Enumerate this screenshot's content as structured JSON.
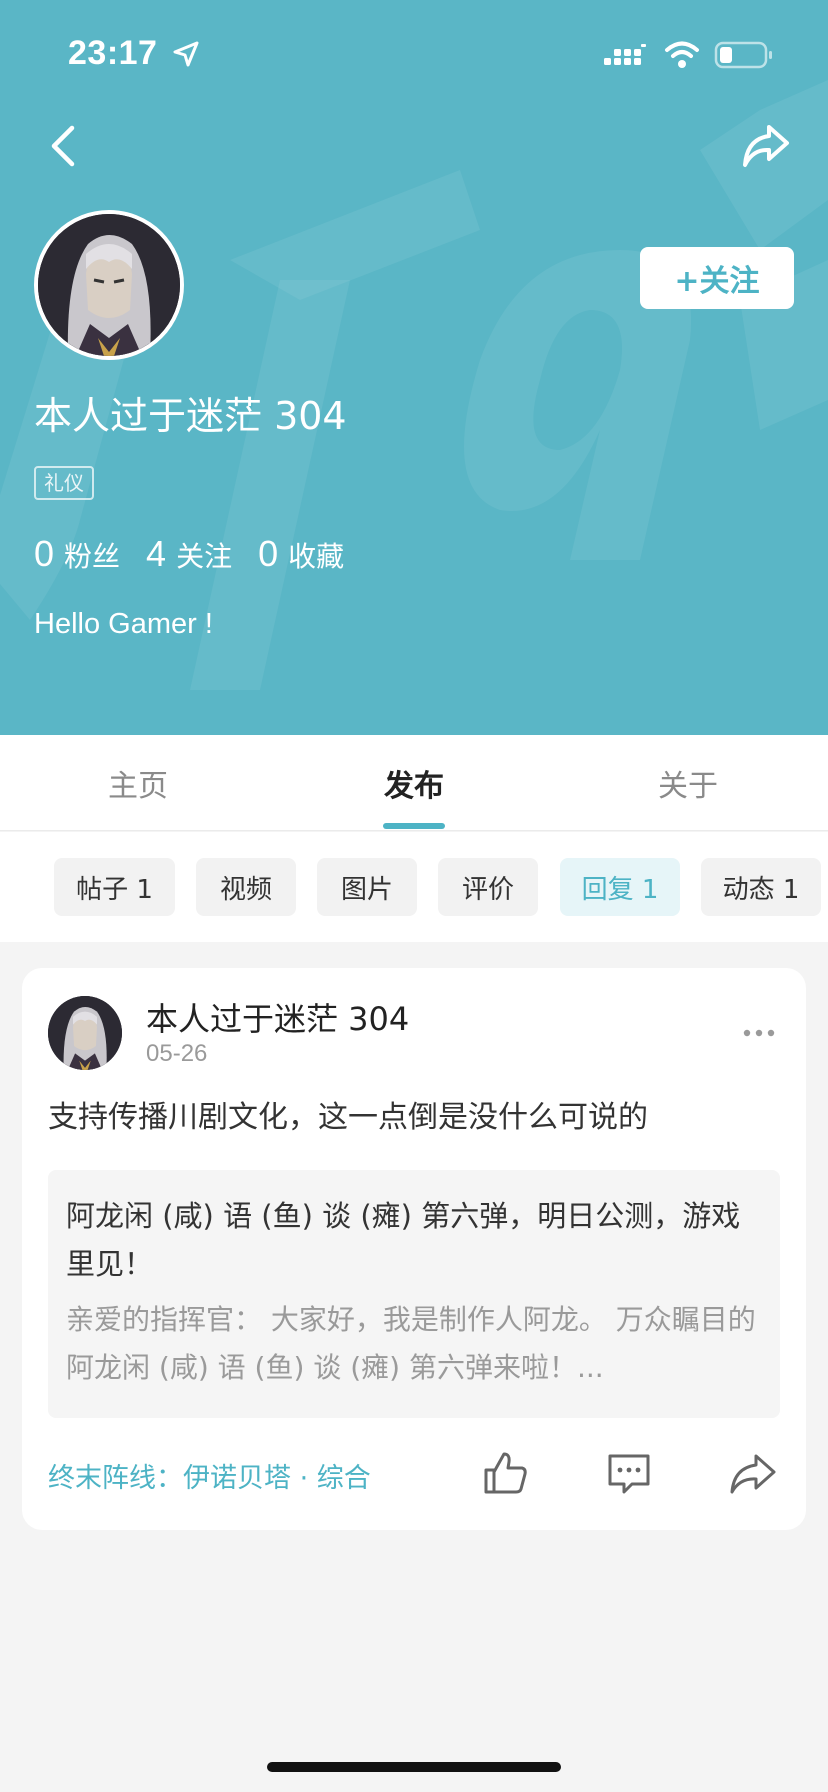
{
  "status_bar": {
    "time": "23:17"
  },
  "profile": {
    "name": "本人过于迷茫 304",
    "badge": "礼仪",
    "follow_label": "+关注",
    "stats": [
      {
        "num": "0",
        "label": "粉丝"
      },
      {
        "num": "4",
        "label": "关注"
      },
      {
        "num": "0",
        "label": "收藏"
      }
    ],
    "bio": "Hello Gamer !"
  },
  "tabs": {
    "home": "主页",
    "publish": "发布",
    "about": "关于",
    "active": "发布"
  },
  "filters": {
    "posts": "帖子 1",
    "videos": "视频",
    "images": "图片",
    "reviews": "评价",
    "replies": "回复 1",
    "activity": "动态 1",
    "active": "回复 1"
  },
  "post": {
    "author": "本人过于迷茫 304",
    "date": "05-26",
    "text": "支持传播川剧文化，这一点倒是没什么可说的",
    "quote_title": "阿龙闲 (咸) 语 (鱼) 谈 (瘫) 第六弹，明日公测，游戏里见！",
    "quote_body": "亲爱的指挥官： 大家好，我是制作人阿龙。 万众瞩目的 阿龙闲 (咸) 语 (鱼) 谈 (瘫) 第六弹来啦！...",
    "forum": "终末阵线：伊诺贝塔 · 综合"
  },
  "colors": {
    "header_bg": "#5ab6c6",
    "accent": "#4db3c5"
  }
}
